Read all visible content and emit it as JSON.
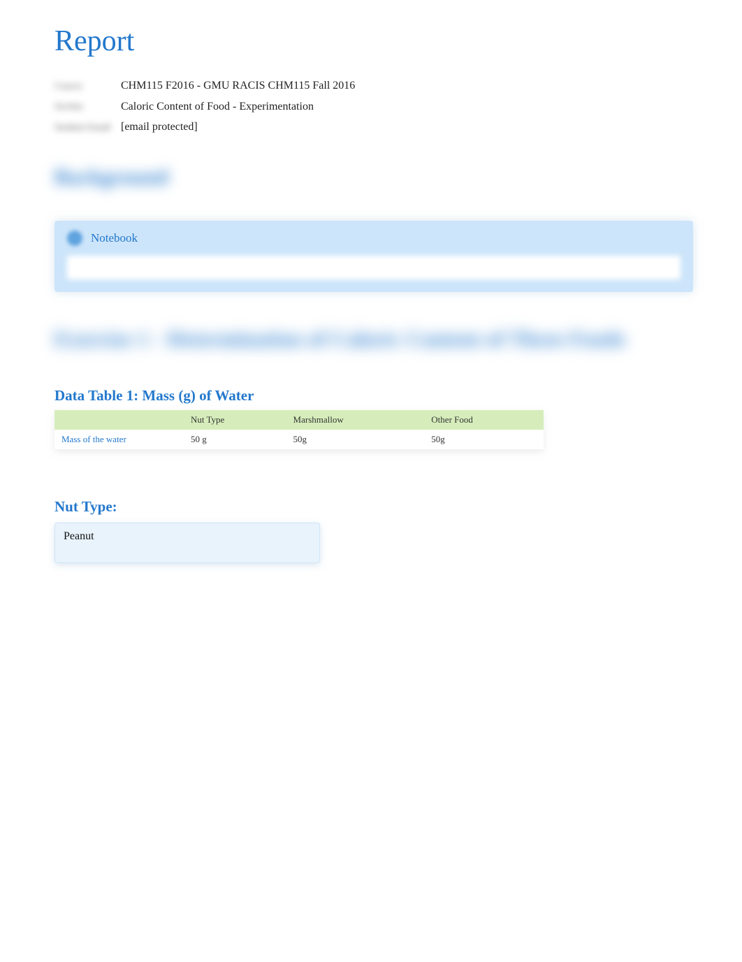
{
  "title": "Report",
  "meta": {
    "rows": [
      {
        "label": "Course",
        "value": "CHM115 F2016 - GMU RACIS CHM115 Fall 2016"
      },
      {
        "label": "Section",
        "value": "Caloric Content of Food - Experimentation"
      },
      {
        "label": "Student Email",
        "value": "[email protected]"
      }
    ]
  },
  "background_heading": "Background",
  "notebook": {
    "title": "Notebook",
    "input_value": ""
  },
  "exercise_heading": "Exercise 1 - Determination of Caloric Content of Three Foods",
  "table1": {
    "caption": "Data Table 1: Mass (g) of Water",
    "headers": [
      "",
      "Nut Type",
      "Marshmallow",
      "Other Food"
    ],
    "row_label": "Mass of the water",
    "row_values": [
      "50 g",
      "50g",
      "50g"
    ]
  },
  "nut_type": {
    "label": "Nut Type:",
    "value": "Peanut"
  }
}
